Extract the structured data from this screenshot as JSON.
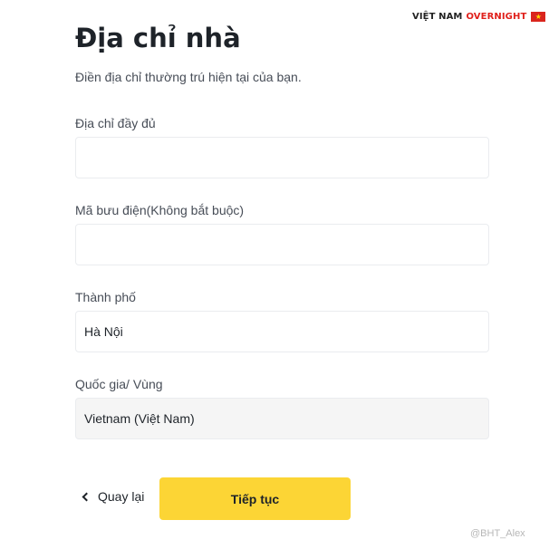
{
  "brand": {
    "part1": "VIỆT NAM",
    "part2": "OVERNIGHT",
    "flag_glyph": "★"
  },
  "page": {
    "title": "Địa chỉ nhà",
    "subtitle": "Điền địa chỉ thường trú hiện tại của bạn."
  },
  "form": {
    "address_label": "Địa chỉ đầy đủ",
    "address_value": "",
    "postal_label": "Mã bưu điện(Không bắt buộc)",
    "postal_value": "",
    "city_label": "Thành phố",
    "city_value": "Hà Nội",
    "country_label": "Quốc gia/ Vùng",
    "country_value": "Vietnam (Việt Nam)"
  },
  "actions": {
    "back_label": "Quay lại",
    "next_label": "Tiếp tục"
  },
  "watermark": "@BHT_Alex",
  "colors": {
    "accent": "#fcd535",
    "brand_red": "#e0201b",
    "text": "#1e2329",
    "muted": "#474d57",
    "disabled_bg": "#f5f5f5"
  }
}
